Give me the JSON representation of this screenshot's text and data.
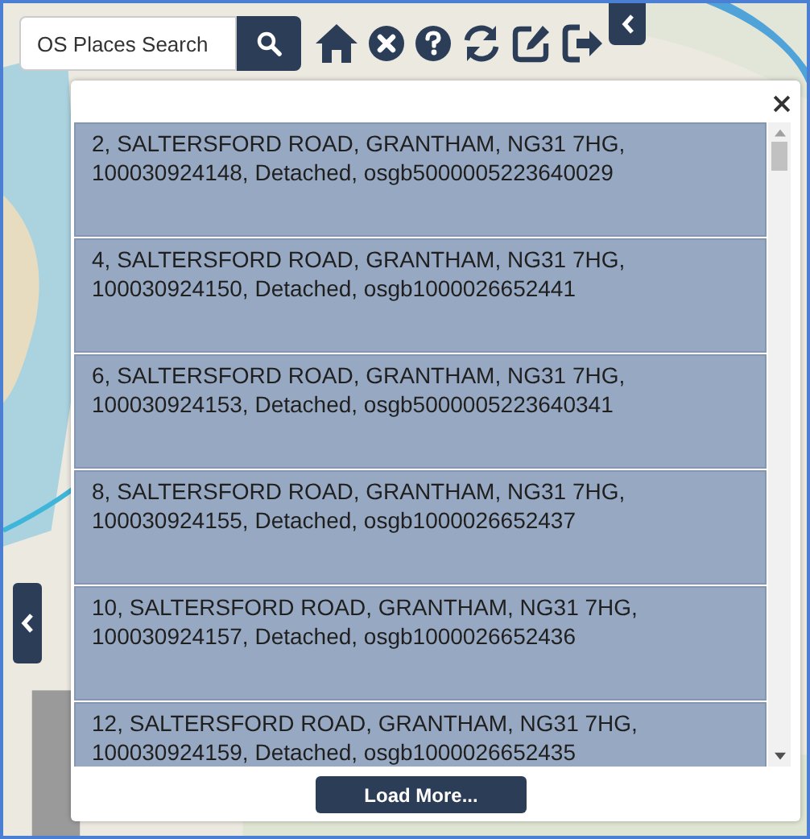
{
  "search": {
    "source": "OS Places Search"
  },
  "results": [
    {
      "text": "2, SALTERSFORD ROAD, GRANTHAM, NG31 7HG, 100030924148, Detached, osgb5000005223640029"
    },
    {
      "text": "4, SALTERSFORD ROAD, GRANTHAM, NG31 7HG, 100030924150, Detached, osgb1000026652441"
    },
    {
      "text": "6, SALTERSFORD ROAD, GRANTHAM, NG31 7HG, 100030924153, Detached, osgb5000005223640341"
    },
    {
      "text": "8, SALTERSFORD ROAD, GRANTHAM, NG31 7HG, 100030924155, Detached, osgb1000026652437"
    },
    {
      "text": "10, SALTERSFORD ROAD, GRANTHAM, NG31 7HG, 100030924157, Detached, osgb1000026652436"
    },
    {
      "text": "12, SALTERSFORD ROAD, GRANTHAM, NG31 7HG, 100030924159, Detached, osgb1000026652435"
    }
  ],
  "load_more": "Load More..."
}
